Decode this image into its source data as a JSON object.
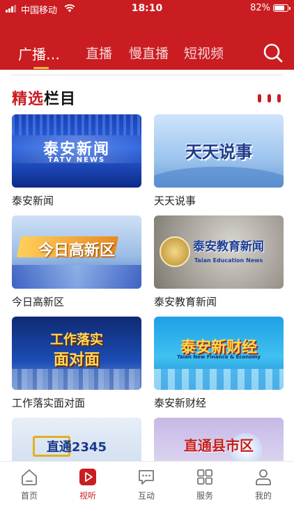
{
  "status_bar": {
    "carrier": "中国移动",
    "time": "18:10",
    "battery_percent": "82%",
    "battery_level": 0.82
  },
  "top_tabs": [
    {
      "label": "广播…",
      "active": true
    },
    {
      "label": "直播",
      "active": false
    },
    {
      "label": "慢直播",
      "active": false
    },
    {
      "label": "短视频",
      "active": false
    }
  ],
  "search": {
    "icon": "search-icon"
  },
  "section": {
    "title_highlight": "精选",
    "title_rest": "栏目"
  },
  "programs": [
    {
      "title": "泰安新闻",
      "thumb_text": "泰安新闻",
      "thumb_sub": "TATV NEWS"
    },
    {
      "title": "天天说事",
      "thumb_text": "天天说事",
      "thumb_sub": ""
    },
    {
      "title": "今日高新区",
      "thumb_text": "今日高新区",
      "thumb_sub": ""
    },
    {
      "title": "泰安教育新闻",
      "thumb_text": "泰安教育新闻",
      "thumb_sub": "Taian Education News"
    },
    {
      "title": "工作落实面对面",
      "thumb_text": "工作落实",
      "thumb_sub": "面对面"
    },
    {
      "title": "泰安新财经",
      "thumb_text": "泰安新财经",
      "thumb_sub": "Taian New Finance & Economy"
    },
    {
      "title": "",
      "thumb_text": "直通2345",
      "thumb_sub": ""
    },
    {
      "title": "",
      "thumb_text": "直通县市区",
      "thumb_sub": ""
    }
  ],
  "bottom_nav": [
    {
      "label": "首页",
      "icon": "home-icon",
      "active": false
    },
    {
      "label": "视听",
      "icon": "play-icon",
      "active": true
    },
    {
      "label": "互动",
      "icon": "chat-icon",
      "active": false
    },
    {
      "label": "服务",
      "icon": "grid-icon",
      "active": false
    },
    {
      "label": "我的",
      "icon": "user-icon",
      "active": false
    }
  ],
  "colors": {
    "brand_red": "#c91d22",
    "tab_indicator": "#f6b93b"
  }
}
